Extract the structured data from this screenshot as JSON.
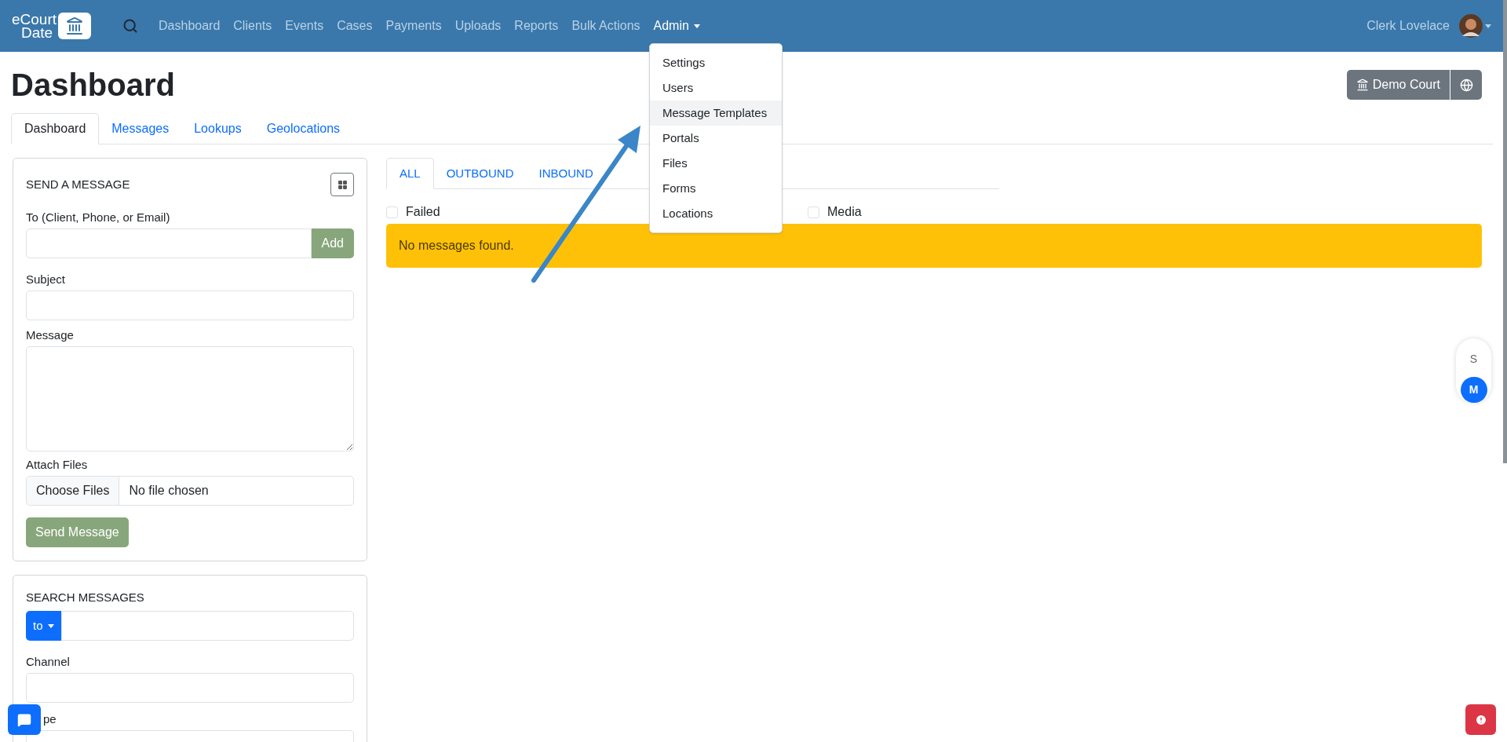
{
  "navbar": {
    "logo": {
      "line1": "eCourt",
      "line2": "Date"
    },
    "links": [
      {
        "label": "Dashboard",
        "selected": false
      },
      {
        "label": "Clients",
        "selected": false
      },
      {
        "label": "Events",
        "selected": false
      },
      {
        "label": "Cases",
        "selected": false
      },
      {
        "label": "Payments",
        "selected": false
      },
      {
        "label": "Uploads",
        "selected": false
      },
      {
        "label": "Reports",
        "selected": false
      },
      {
        "label": "Bulk Actions",
        "selected": false
      },
      {
        "label": "Admin",
        "selected": true
      }
    ],
    "user": "Clerk Lovelace"
  },
  "admin_menu": [
    {
      "label": "Settings",
      "selected": false
    },
    {
      "label": "Users",
      "selected": false
    },
    {
      "label": "Message Templates",
      "selected": true
    },
    {
      "label": "Portals",
      "selected": false
    },
    {
      "label": "Files",
      "selected": false
    },
    {
      "label": "Forms",
      "selected": false
    },
    {
      "label": "Locations",
      "selected": false
    }
  ],
  "page": {
    "title": "Dashboard",
    "court_button": "Demo Court"
  },
  "tabs": [
    {
      "label": "Dashboard",
      "selected": true
    },
    {
      "label": "Messages",
      "selected": false
    },
    {
      "label": "Lookups",
      "selected": false
    },
    {
      "label": "Geolocations",
      "selected": false
    }
  ],
  "send_message": {
    "title": "SEND A MESSAGE",
    "to_label": "To (Client, Phone, or Email)",
    "add_button": "Add",
    "subject_label": "Subject",
    "message_label": "Message",
    "attach_label": "Attach Files",
    "choose_button": "Choose Files",
    "file_status": "No file chosen",
    "send_button": "Send Message"
  },
  "search_messages": {
    "title": "SEARCH MESSAGES",
    "filter_button": "to",
    "channel_label": "Channel",
    "type_label": "pe"
  },
  "message_tabs": [
    {
      "label": "ALL",
      "selected": true
    },
    {
      "label": "OUTBOUND",
      "selected": false
    },
    {
      "label": "INBOUND",
      "selected": false
    }
  ],
  "filters": [
    {
      "label": "Failed",
      "checked": false
    },
    {
      "label": "Media",
      "checked": false
    }
  ],
  "alert": "No messages found.",
  "side_switch": [
    {
      "label": "S",
      "selected": false
    },
    {
      "label": "M",
      "selected": true
    }
  ]
}
